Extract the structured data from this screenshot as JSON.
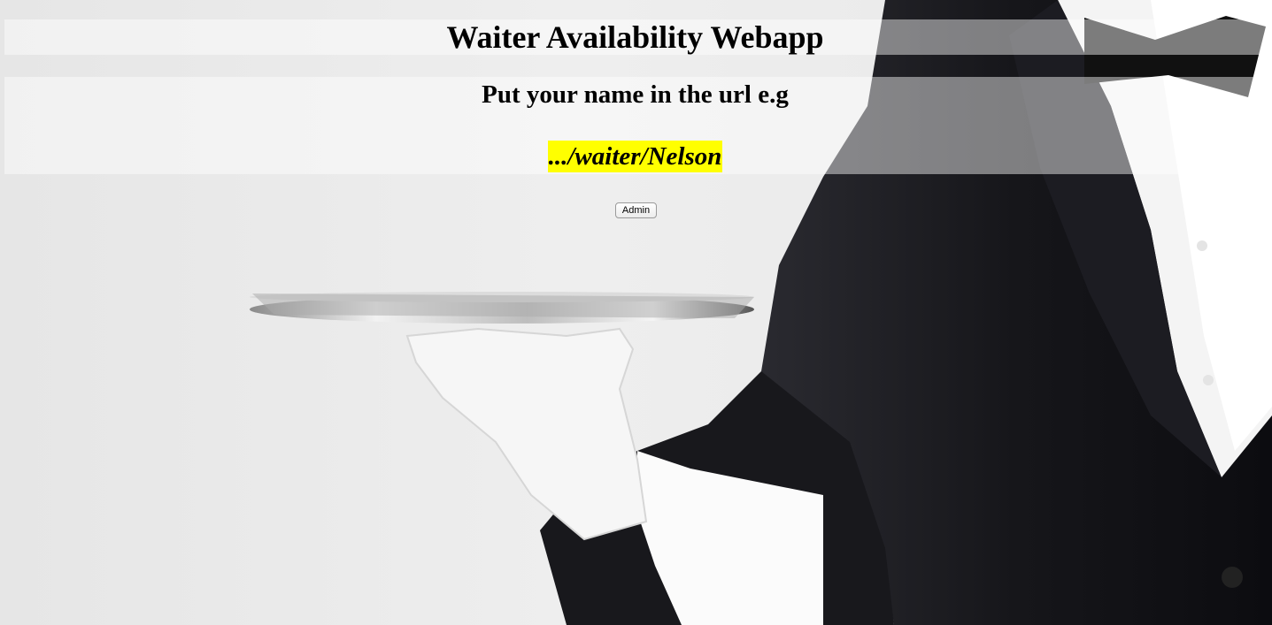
{
  "header": {
    "title": "Waiter Availability Webapp"
  },
  "instructions": {
    "text": "Put your name in the url e.g",
    "url_example": ".../waiter/Nelson",
    "highlight_color": "#ffff00"
  },
  "actions": {
    "admin_label": "Admin"
  },
  "background": {
    "image": "waiter-holding-silver-tray"
  }
}
